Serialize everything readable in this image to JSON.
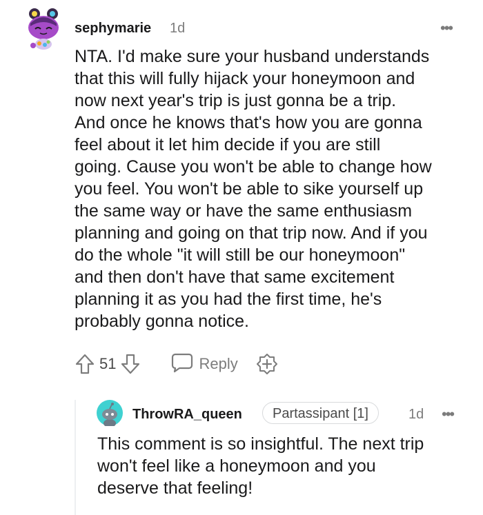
{
  "comment": {
    "username": "sephymarie",
    "time": "1d",
    "more_label": "•••",
    "avatar_icon": "snoo-avatar-purple-icon",
    "body_lines": [
      "NTA. I'd make sure your husband understands",
      "that this will fully hijack your honeymoon and",
      "now next year's trip is just gonna be a trip.",
      "And once he knows that's how you are gonna",
      "feel about it let him decide if you are still",
      "going. Cause you won't be able to change how",
      "you feel. You won't be able to sike yourself up",
      "the same way or have the same enthusiasm",
      "planning and going on that trip now. And if you",
      "do the whole \"it will still be our honeymoon\"",
      "and then don't have that same excitement",
      "planning it as you had the first time, he's",
      "probably gonna notice."
    ],
    "actions": {
      "upvote_icon": "upvote-arrow-icon",
      "vote_count": "51",
      "downvote_icon": "downvote-arrow-icon",
      "reply_icon": "speech-bubble-icon",
      "reply_label": "Reply",
      "award_icon": "award-plus-icon"
    }
  },
  "reply": {
    "username": "ThrowRA_queen",
    "flair": "Partassipant [1]",
    "time": "1d",
    "more_label": "•••",
    "avatar_icon": "snoo-avatar-teal-icon",
    "body_lines": [
      "This comment is so insightful. The next trip",
      "won't feel like a honeymoon and you",
      "deserve that feeling!"
    ]
  },
  "colors": {
    "text": "#1a1a1b",
    "meta": "#7c7c7c",
    "avatar_purple": "#a64bc8",
    "avatar_teal": "#3fd1d1",
    "thread_line": "#edeff1"
  }
}
